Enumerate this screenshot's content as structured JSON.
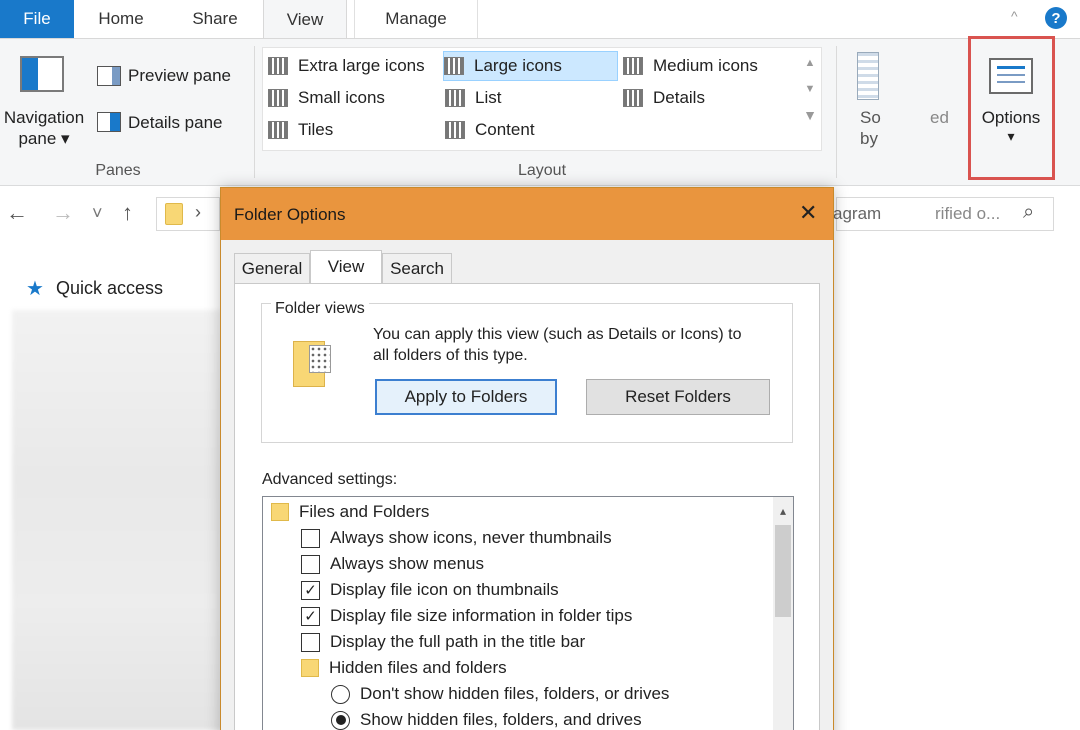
{
  "ribbon": {
    "tabs": {
      "file": "File",
      "home": "Home",
      "share": "Share",
      "view": "View",
      "manage": "Manage"
    },
    "help_glyph": "?",
    "collapse_glyph": "^",
    "panes": {
      "navigation_pane_line1": "Navigation",
      "navigation_pane_line2": "pane ▾",
      "preview_pane": "Preview pane",
      "details_pane": "Details pane",
      "group_label": "Panes"
    },
    "layout": {
      "items": [
        {
          "label": "Extra large icons",
          "selected": false
        },
        {
          "label": "Large icons",
          "selected": true
        },
        {
          "label": "Medium icons",
          "selected": false
        },
        {
          "label": "Small icons",
          "selected": false
        },
        {
          "label": "List",
          "selected": false
        },
        {
          "label": "Details",
          "selected": false
        },
        {
          "label": "Tiles",
          "selected": false
        },
        {
          "label": "Content",
          "selected": false
        }
      ],
      "group_label": "Layout"
    },
    "current_view": {
      "sort_line1": "So",
      "sort_line2": "by",
      "partial_label": "ed"
    },
    "options": {
      "label": "Options",
      "arrow": "▾"
    }
  },
  "address_bar": {
    "back_glyph": "←",
    "forward_glyph": "→",
    "recent_glyph": "˅",
    "up_glyph": "↑",
    "chevron": "›",
    "search_partial_left": "agram",
    "search_partial_right": "rified o...",
    "search_glyph": "⌕"
  },
  "nav_pane": {
    "quick_access": "Quick access"
  },
  "dialog": {
    "title": "Folder Options",
    "close_glyph": "✕",
    "tabs": {
      "general": "General",
      "view": "View",
      "search": "Search"
    },
    "folder_views": {
      "label": "Folder views",
      "text_line1": "You can apply this view (such as Details or Icons) to",
      "text_line2": "all folders of this type.",
      "apply_button": "Apply to Folders",
      "reset_button": "Reset Folders"
    },
    "advanced": {
      "label": "Advanced settings:",
      "items": [
        {
          "kind": "folder",
          "label": "Files and Folders"
        },
        {
          "kind": "checkbox",
          "label": "Always show icons, never thumbnails",
          "checked": false
        },
        {
          "kind": "checkbox",
          "label": "Always show menus",
          "checked": false
        },
        {
          "kind": "checkbox",
          "label": "Display file icon on thumbnails",
          "checked": true
        },
        {
          "kind": "checkbox",
          "label": "Display file size information in folder tips",
          "checked": true
        },
        {
          "kind": "checkbox",
          "label": "Display the full path in the title bar",
          "checked": false
        },
        {
          "kind": "folder",
          "label": "Hidden files and folders"
        },
        {
          "kind": "radio",
          "label": "Don't show hidden files, folders, or drives",
          "checked": false
        },
        {
          "kind": "radio",
          "label": "Show hidden files, folders, and drives",
          "checked": true
        }
      ],
      "check_glyph": "✓",
      "scroll_up_glyph": "▴"
    }
  },
  "colors": {
    "file_tab": "#1979ca",
    "dialog_title": "#e9953e",
    "highlight": "#d9534f",
    "selection": "#cce8ff"
  }
}
